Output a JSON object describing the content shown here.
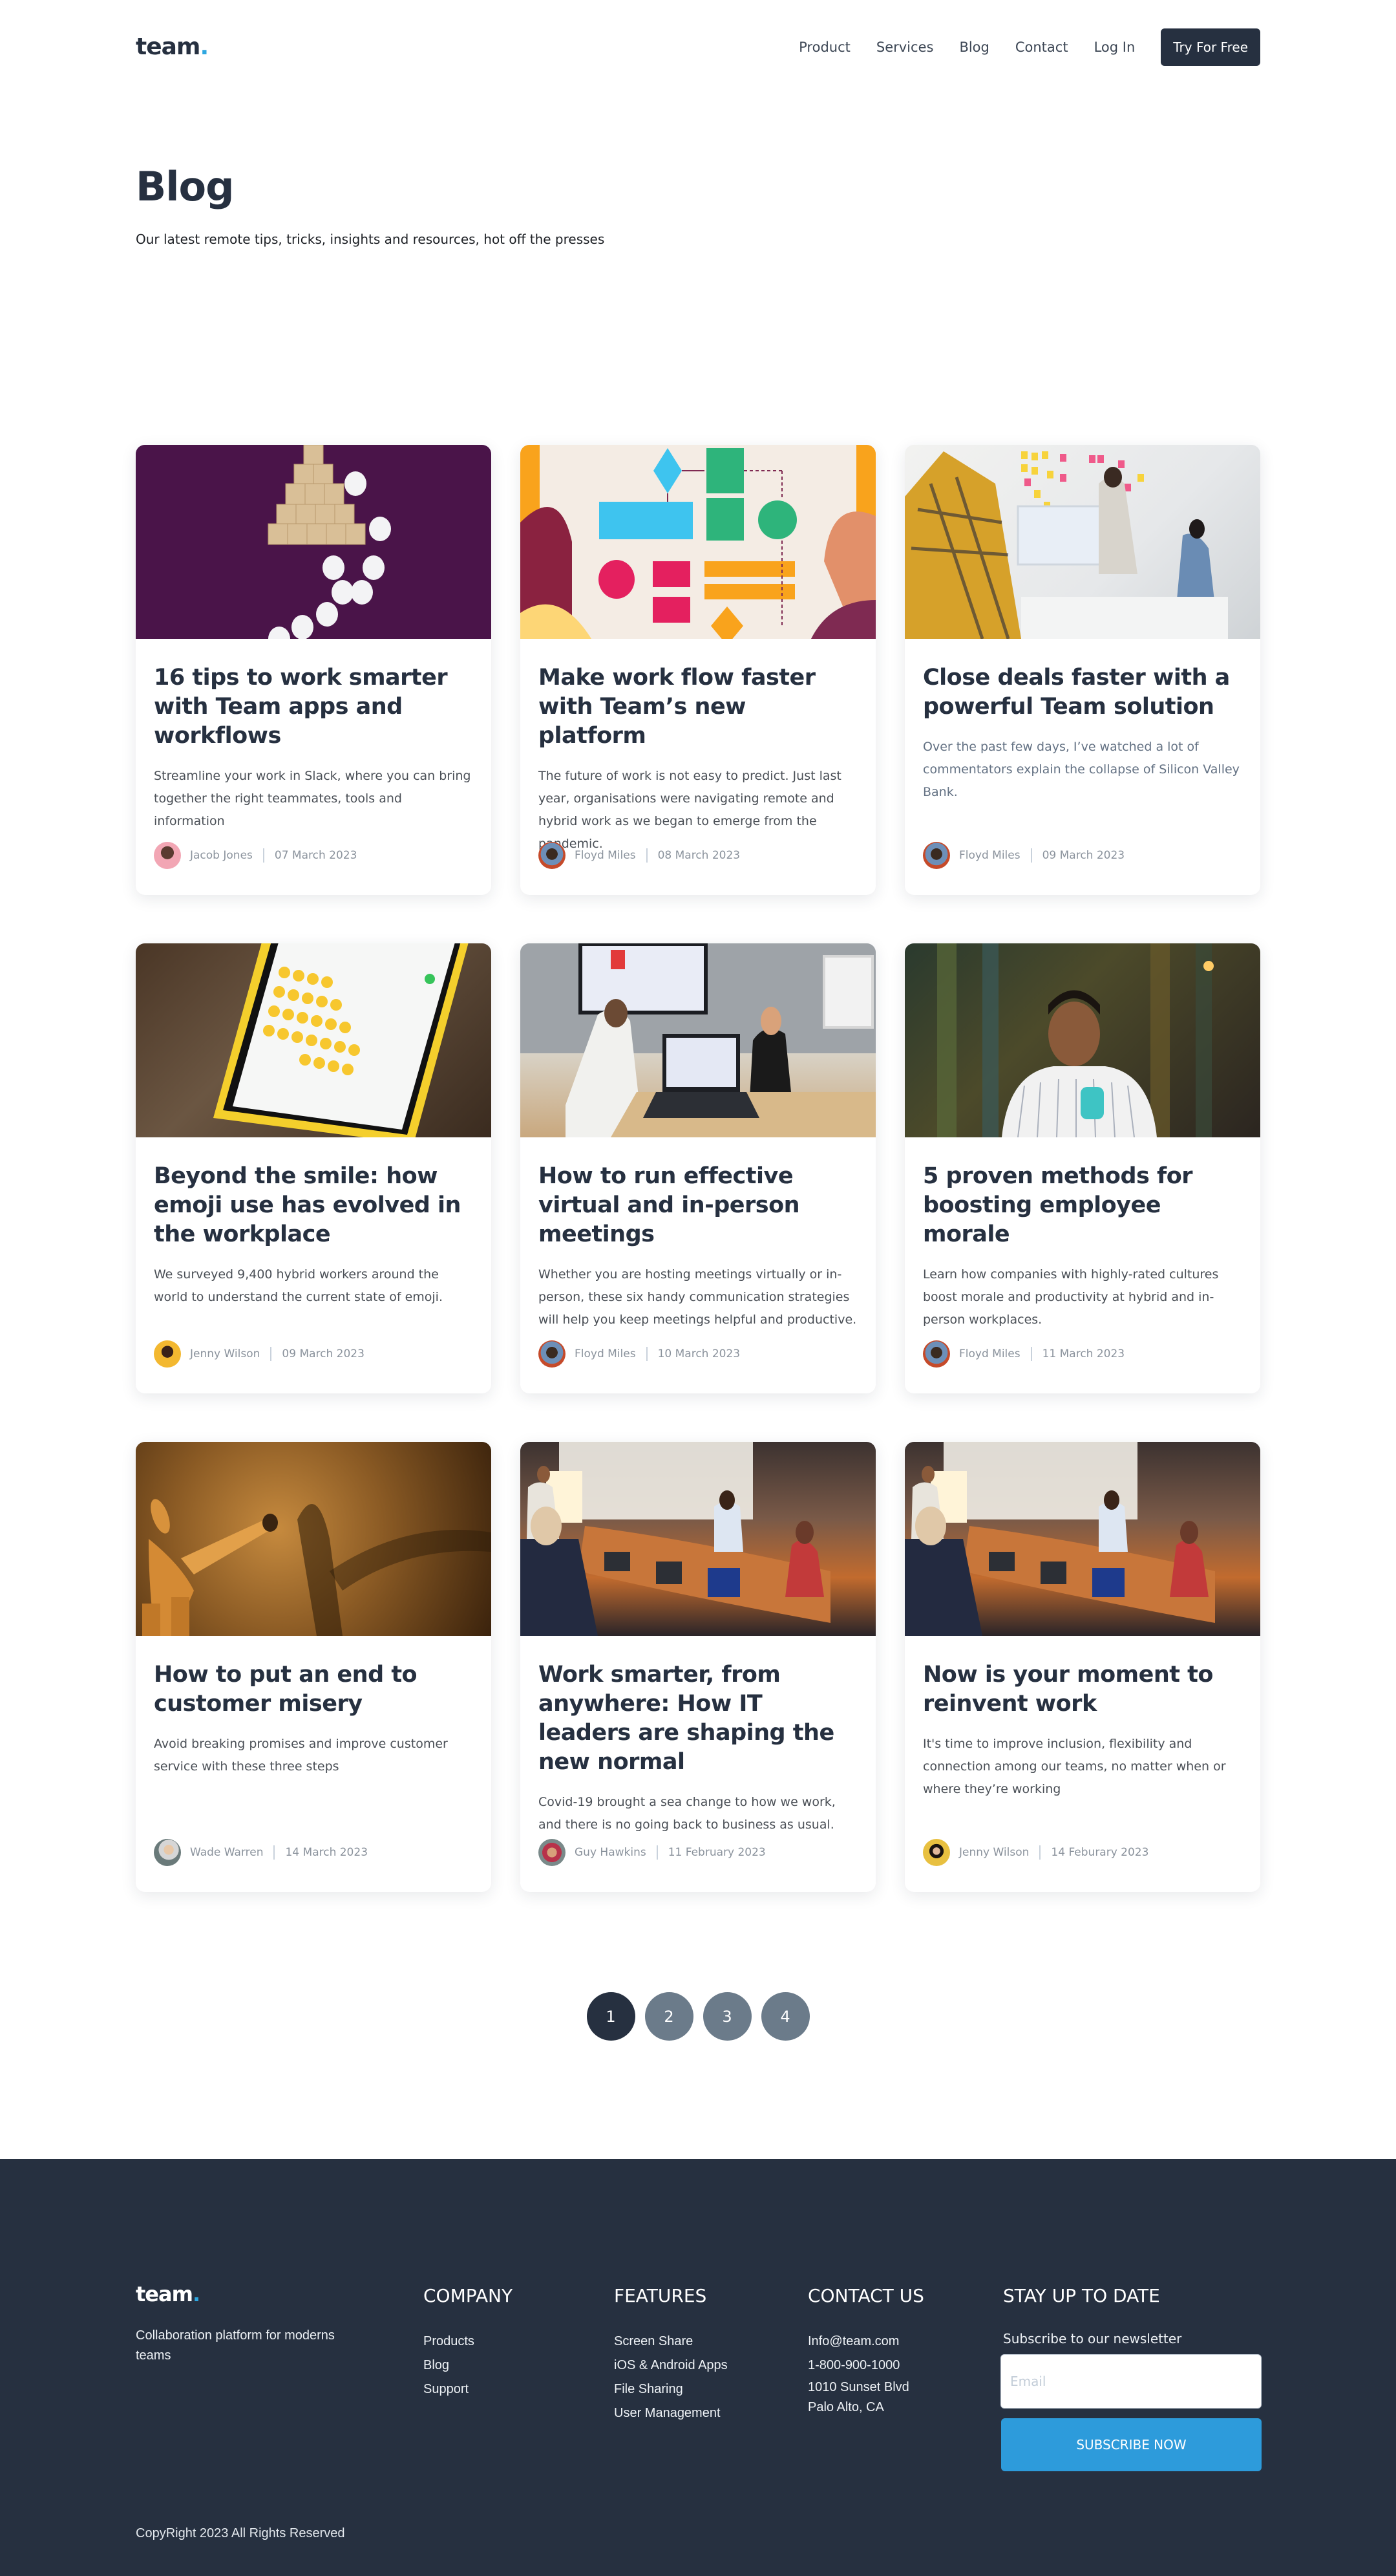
{
  "header": {
    "logo_text": "team",
    "logo_dot": ".",
    "nav": [
      {
        "label": "Product"
      },
      {
        "label": "Services"
      },
      {
        "label": "Blog"
      },
      {
        "label": "Contact"
      },
      {
        "label": "Log In"
      }
    ],
    "cta_label": "Try For Free"
  },
  "hero": {
    "title": "Blog",
    "subtitle": "Our latest remote tips, tricks, insights and resources, hot off the presses"
  },
  "posts": [
    {
      "image": "wooden-blocks-pyramid-image",
      "title": "16 tips to work smarter with Team apps and workflows",
      "excerpt": "Streamline your work in Slack, where you can bring together the right teammates, tools and information",
      "author": "Jacob Jones",
      "date": "07 March 2023"
    },
    {
      "image": "workflow-diagram-illustration",
      "title": "Make work flow faster with Team’s new platform",
      "excerpt": "The future of work is not easy to predict. Just last year, organisations were navigating remote and hybrid work as we began to emerge from the pandemic.",
      "author": "Floyd Miles",
      "date": "08 March 2023"
    },
    {
      "image": "office-team-meeting-photo",
      "title": "Close deals faster with a powerful Team solution",
      "excerpt": "Over the past few days, I’ve watched a lot of commentators explain the collapse of Silicon Valley Bank.",
      "author": "Floyd Miles",
      "date": "09 March 2023"
    },
    {
      "image": "phone-emoji-keyboard-photo",
      "title": "Beyond the smile: how emoji use has evolved in the workplace",
      "excerpt": "We surveyed 9,400 hybrid workers around the world to understand the current state of emoji.",
      "author": "Jenny Wilson",
      "date": "09 March 2023"
    },
    {
      "image": "meeting-room-laptop-photo",
      "title": "How to run effective virtual and in-person meetings",
      "excerpt": "Whether you are hosting meetings virtually or in-person, these six handy communication strategies will help you keep meetings helpful and productive.",
      "author": "Floyd Miles",
      "date": "10 March 2023"
    },
    {
      "image": "man-with-drink-bar-photo",
      "title": "5 proven methods for boosting employee morale",
      "excerpt": "Learn how companies with highly-rated cultures boost morale and productivity at hybrid and in-person workplaces.",
      "author": "Floyd Miles",
      "date": "11 March 2023"
    },
    {
      "image": "wooden-mannequin-photo",
      "title": "How to put an end to customer misery",
      "excerpt": "Avoid breaking promises and improve customer service with these three steps",
      "author": "Wade Warren",
      "date": "14 March 2023"
    },
    {
      "image": "conference-table-photo",
      "title": "Work smarter, from anywhere: How IT leaders are shaping the new normal",
      "excerpt": "Covid-19 brought a sea change to how we work, and there is no going back to business as usual.",
      "author": "Guy Hawkins",
      "date": "11 February 2023"
    },
    {
      "image": "conference-table-photo",
      "title": "Now is your moment to reinvent work",
      "excerpt": "It's time to improve inclusion, flexibility and connection among our teams, no matter when or where they’re working",
      "author": "Jenny Wilson",
      "date": "14 Feburary 2023"
    }
  ],
  "pagination": {
    "pages": [
      "1",
      "2",
      "3",
      "4"
    ],
    "current": "1"
  },
  "footer": {
    "logo_text": "team",
    "logo_dot": ".",
    "tagline": "Collaboration platform for moderns teams",
    "company": {
      "heading": "COMPANY",
      "links": [
        "Products",
        "Blog",
        "Support"
      ]
    },
    "features": {
      "heading": "FEATURES",
      "links": [
        "Screen Share",
        "iOS & Android Apps",
        "File Sharing",
        "User Management"
      ]
    },
    "contact": {
      "heading": "CONTACT US",
      "email": "Info@team.com",
      "phone": "1-800-900-1000",
      "address_line1": "1010 Sunset Blvd",
      "address_line2": "Palo Alto, CA"
    },
    "newsletter": {
      "heading": "STAY UP TO DATE",
      "subtitle": "Subscribe to our newsletter",
      "email_placeholder": "Email",
      "email_value": "",
      "button_label": "SUBSCRIBE NOW"
    },
    "copyright": "CopyRight 2023 All Rights Reserved"
  },
  "colors": {
    "primary_dark": "#263040",
    "accent_blue": "#2d9bdb",
    "logo_dot": "#2ea7e0",
    "page_inactive": "#6b7b8a"
  }
}
